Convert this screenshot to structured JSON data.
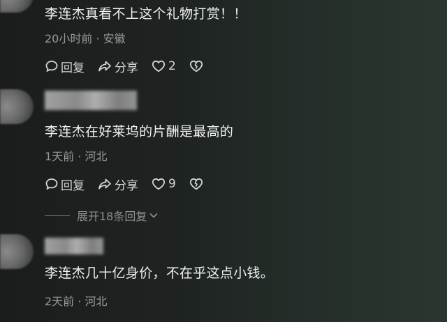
{
  "comments": [
    {
      "text": "李连杰真看不上这个礼物打赏！！",
      "time": "20小时前",
      "location": "安徽",
      "reply_label": "回复",
      "share_label": "分享",
      "likes": "2"
    },
    {
      "text": "李连杰在好莱坞的片酬是最高的",
      "time": "1天前",
      "location": "河北",
      "reply_label": "回复",
      "share_label": "分享",
      "likes": "9",
      "expand_replies": "展开18条回复"
    },
    {
      "text": "李连杰几十亿身价，不在乎这点小钱。",
      "time": "2天前",
      "location": "河北"
    }
  ],
  "meta_separator": " · ",
  "icons": {
    "reply": "comment-bubble-icon",
    "share": "share-arrow-icon",
    "like": "heart-icon",
    "dislike": "broken-heart-icon",
    "expand": "chevron-down-icon"
  }
}
